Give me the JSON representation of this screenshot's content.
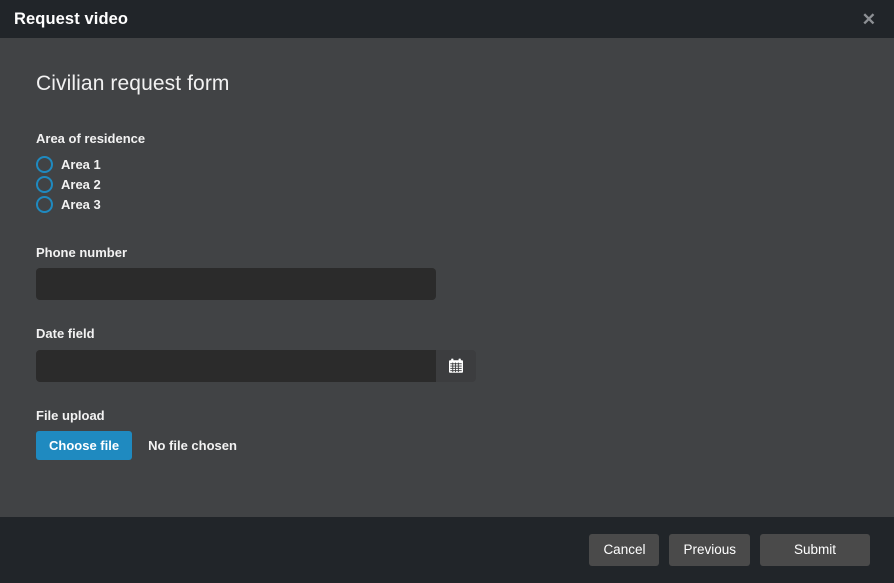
{
  "header": {
    "title": "Request video",
    "close_label": "✕"
  },
  "form": {
    "title": "Civilian request form",
    "area": {
      "label": "Area of residence",
      "options": [
        {
          "label": "Area 1",
          "checked": false
        },
        {
          "label": "Area 2",
          "checked": false
        },
        {
          "label": "Area 3",
          "checked": false
        }
      ]
    },
    "phone": {
      "label": "Phone number",
      "value": "",
      "placeholder": ""
    },
    "date": {
      "label": "Date field",
      "value": "",
      "placeholder": "",
      "calendar_icon": "calendar-icon"
    },
    "file_upload": {
      "label": "File upload",
      "button_label": "Choose file",
      "status": "No file chosen"
    }
  },
  "footer": {
    "cancel_label": "Cancel",
    "previous_label": "Previous",
    "submit_label": "Submit"
  },
  "colors": {
    "header_bg": "#212529",
    "body_bg": "#414345",
    "footer_bg": "#212529",
    "input_bg": "#2b2b2b",
    "accent_blue": "#1f8ac0",
    "button_grey": "#4a4a4a",
    "text": "#f2f2f2"
  }
}
